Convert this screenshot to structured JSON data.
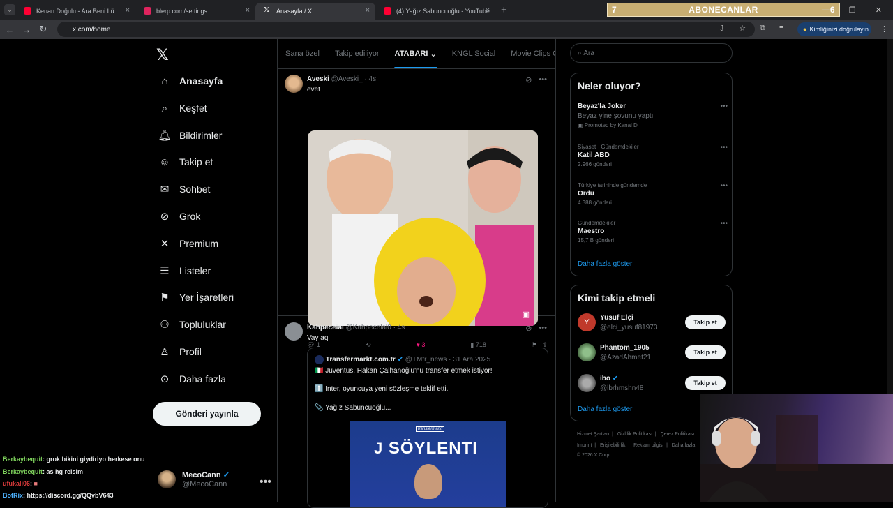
{
  "browser": {
    "tabs": [
      {
        "title": "Kenan Doğulu - Ara Beni Lü",
        "favicon_color": "#ff0033",
        "audio": true
      },
      {
        "title": "blerp.com/settings",
        "favicon_color": "#e0245e"
      },
      {
        "title": "Anasayfa / X",
        "favicon_color": "#ffffff",
        "active": true
      },
      {
        "title": "(4) Yağız Sabuncuoğlu - YouTube",
        "favicon_color": "#ff0033"
      }
    ],
    "url": "x.com/home",
    "verify_label": "Kimliğinizi doğrulayın"
  },
  "overlay_bar": {
    "left": "7",
    "label": "ABONECANLAR",
    "right": "6"
  },
  "sidebar": {
    "logo": "𝕏",
    "items": [
      {
        "label": "Anasayfa",
        "icon": "home-icon"
      },
      {
        "label": "Keşfet",
        "icon": "search-icon"
      },
      {
        "label": "Bildirimler",
        "icon": "bell-icon"
      },
      {
        "label": "Takip et",
        "icon": "person-add-icon"
      },
      {
        "label": "Sohbet",
        "icon": "mail-icon"
      },
      {
        "label": "Grok",
        "icon": "grok-icon"
      },
      {
        "label": "Premium",
        "icon": "x-icon"
      },
      {
        "label": "Listeler",
        "icon": "list-icon"
      },
      {
        "label": "Yer İşaretleri",
        "icon": "bookmark-icon"
      },
      {
        "label": "Topluluklar",
        "icon": "community-icon"
      },
      {
        "label": "Profil",
        "icon": "profile-icon"
      },
      {
        "label": "Daha fazla",
        "icon": "more-circle-icon"
      }
    ],
    "post_button": "Gönderi yayınla",
    "profile": {
      "name": "MecoCann",
      "handle": "@MecoCann"
    }
  },
  "feed": {
    "tabs": [
      "Sana özel",
      "Takip ediliyor",
      "ATABARI",
      "KNGL Social",
      "Movie Clips Com"
    ],
    "tweets": [
      {
        "name": "Aveski",
        "handle": "@Aveski_",
        "time": "· 4s",
        "text": "evet",
        "replies": "1",
        "likes": "3",
        "views": "718"
      },
      {
        "name": "Kahpecelal",
        "handle": "@Kahpecelal0",
        "time": "· 4s",
        "text": "Vay aq",
        "quote": {
          "name": "Transfermarkt.com.tr",
          "handle": "@TMtr_news",
          "date": "· 31 Ara 2025",
          "line1": "🇮🇹 Juventus, Hakan Çalhanoğlu'nu transfer etmek istiyor!",
          "line2": "ℹ️ Inter, oyuncuya yeni sözleşme teklif etti.",
          "line3": "📎 Yağız Sabuncuoğlu...",
          "image_brand": "transfermarkt",
          "image_title": "SÖYLENTI"
        }
      }
    ]
  },
  "right": {
    "search_placeholder": "Ara",
    "trends_title": "Neler oluyor?",
    "trends": [
      {
        "category": "",
        "title": "Beyaz'la Joker",
        "sub": "Beyaz yine şovunu yaptı",
        "posts": "Promoted by Kanal D"
      },
      {
        "category": "Siyaset · Gündemdekiler",
        "title": "Katil ABD",
        "sub": "",
        "posts": "2.966 gönderi"
      },
      {
        "category": "Türkiye tarihinde gündemde",
        "title": "Ordu",
        "sub": "",
        "posts": "4.388 gönderi"
      },
      {
        "category": "Gündemdekiler",
        "title": "Maestro",
        "sub": "",
        "posts": "15,7 B gönderi"
      }
    ],
    "show_more": "Daha fazla göster",
    "who_title": "Kimi takip etmeli",
    "who": [
      {
        "name": "Yusuf Elçi",
        "handle": "@elci_yusuf81973",
        "initial": "Y"
      },
      {
        "name": "Phantom_1905",
        "handle": "@AzadAhmet21",
        "initial": ""
      },
      {
        "name": "ibo",
        "handle": "@lbrhmshn48",
        "initial": ""
      }
    ],
    "follow_label": "Takip et",
    "footer": [
      "Hizmet Şartları",
      "Gizlilik Politikası",
      "Çerez Politikası",
      "Imprint",
      "Erişilebilirlik",
      "Reklam bilgisi",
      "Daha fazla"
    ],
    "copyright": "© 2026 X Corp."
  },
  "chat": [
    {
      "user": "Berkaybequit",
      "msg": ": grok bikini giydiriyo herkese onu"
    },
    {
      "user": "Berkaybequit",
      "msg": ": as hg reisim"
    },
    {
      "user": "ufukali06",
      "msg": ":"
    },
    {
      "user": "BotRix",
      "msg": ": https://discord.gg/QQvbV643"
    }
  ]
}
